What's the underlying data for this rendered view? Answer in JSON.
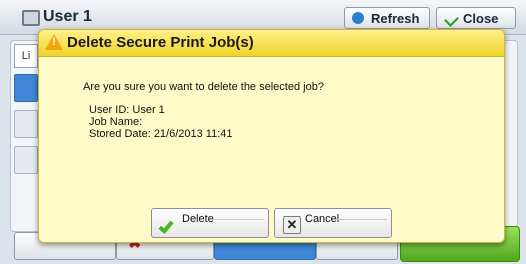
{
  "background": {
    "title": "User 1",
    "refresh_label": "Refresh",
    "close_label": "Close",
    "tab_label": "Li"
  },
  "dialog": {
    "title": "Delete Secure Print Job(s)",
    "question": "Are you sure you want to delete the selected job?",
    "user_id": "User ID: User 1",
    "job_name": "Job Name:",
    "stored_date": "Stored Date: 21/6/2013 11:41",
    "delete_label": "Delete",
    "cancel_label": "Cancel"
  },
  "colors": {
    "dialog_bg": "#fffbc9",
    "titlebar": "#f1d42a",
    "warning": "#f2a60c",
    "check": "#45b822"
  },
  "icons": {
    "warning": "warning-icon",
    "delete": "check-icon",
    "cancel": "x-icon"
  }
}
